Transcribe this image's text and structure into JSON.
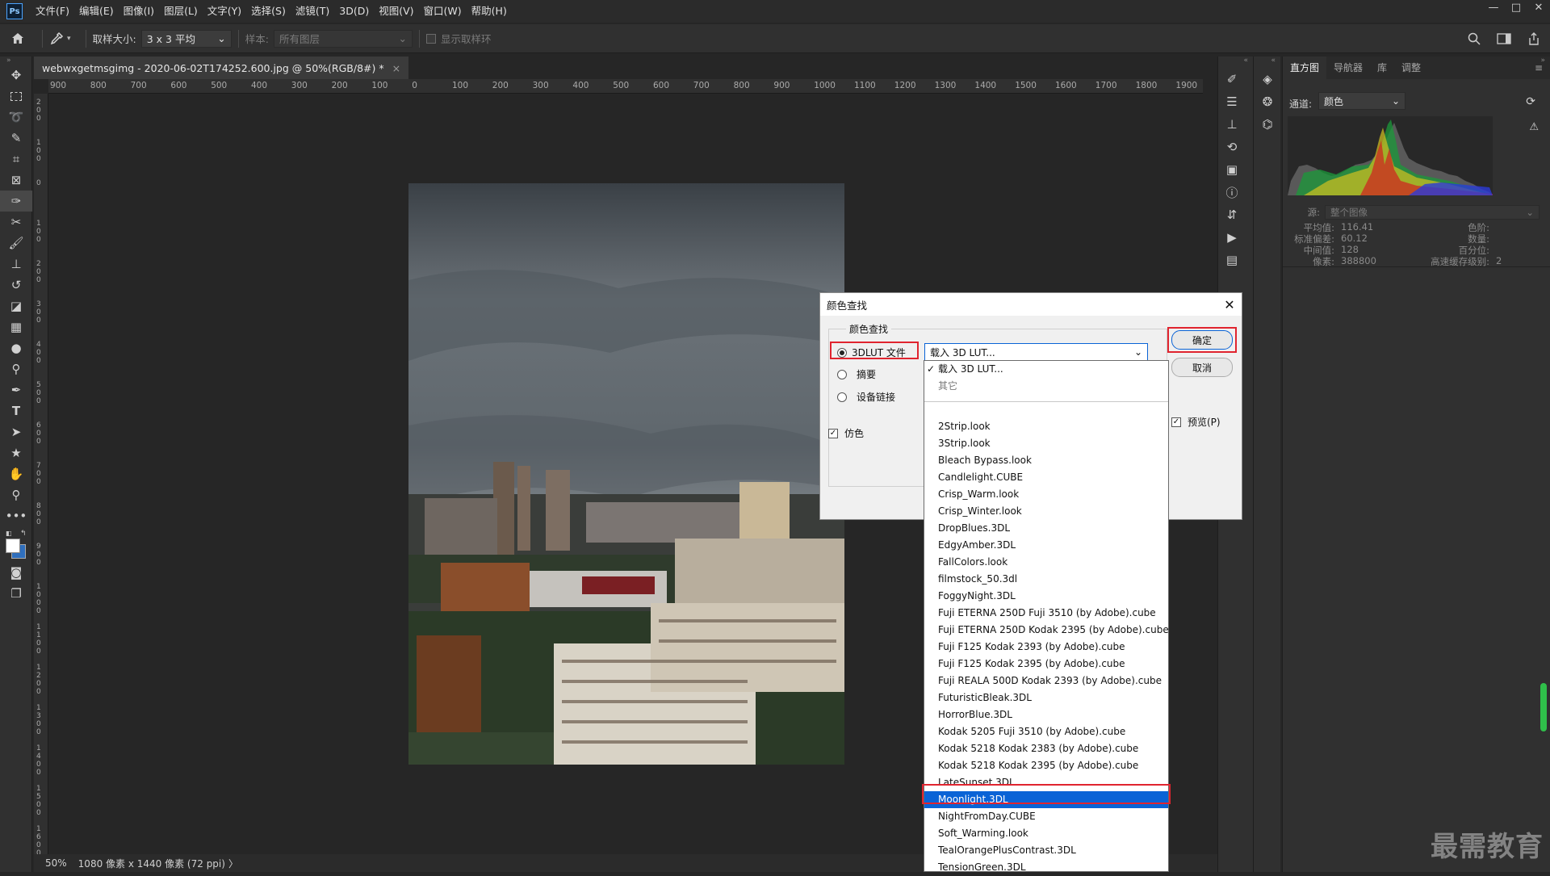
{
  "app": {
    "logo": "Ps",
    "menu": [
      "文件(F)",
      "编辑(E)",
      "图像(I)",
      "图层(L)",
      "文字(Y)",
      "选择(S)",
      "滤镜(T)",
      "3D(D)",
      "视图(V)",
      "窗口(W)",
      "帮助(H)"
    ],
    "window_controls": [
      "—",
      "□",
      "✕"
    ]
  },
  "options": {
    "sample_size_label": "取样大小:",
    "sample_size_value": "3 x 3 平均",
    "sample_label": "样本:",
    "sample_value": "所有图层",
    "show_ring_label": "显示取样环"
  },
  "document": {
    "tab_title": "webwxgetmsgimg - 2020-06-02T174252.600.jpg @ 50%(RGB/8#) *",
    "zoom": "50%",
    "info": "1080 像素 x 1440 像素 (72 ppi)"
  },
  "ruler_top": [
    "900",
    "800",
    "700",
    "600",
    "500",
    "400",
    "300",
    "200",
    "100",
    "0",
    "100",
    "200",
    "300",
    "400",
    "500",
    "600",
    "700",
    "800",
    "900",
    "1000",
    "1100",
    "1200",
    "1300",
    "1400",
    "1500",
    "1600",
    "1700",
    "1800",
    "1900"
  ],
  "ruler_left": [
    "2 0 0",
    "1 0 0",
    "0",
    "1 0 0",
    "2 0 0",
    "3 0 0",
    "4 0 0",
    "5 0 0",
    "6 0 0",
    "7 0 0",
    "8 0 0",
    "9 0 0",
    "1 0 0 0",
    "1 1 0 0",
    "1 2 0 0",
    "1 3 0 0",
    "1 4 0 0",
    "1 5 0 0",
    "1 6 0 0"
  ],
  "histogram": {
    "tabs": [
      "直方图",
      "导航器",
      "库",
      "调整"
    ],
    "channel_label": "通道:",
    "channel_value": "颜色",
    "source_label": "源:",
    "source_value": "整个图像",
    "stats_left": [
      {
        "label": "平均值:",
        "value": "116.41"
      },
      {
        "label": "标准偏差:",
        "value": "60.12"
      },
      {
        "label": "中间值:",
        "value": "128"
      },
      {
        "label": "像素:",
        "value": "388800"
      }
    ],
    "stats_right": [
      {
        "label": "色阶:",
        "value": ""
      },
      {
        "label": "数量:",
        "value": ""
      },
      {
        "label": "百分位:",
        "value": ""
      },
      {
        "label": "高速缓存级别:",
        "value": "2"
      }
    ]
  },
  "dialog": {
    "title": "颜色查找",
    "group_title": "颜色查找",
    "options": [
      "3DLUT 文件",
      "摘要",
      "设备链接"
    ],
    "dither_label": "仿色",
    "lut_select_value": "载入 3D LUT...",
    "ok_label": "确定",
    "cancel_label": "取消",
    "preview_label": "预览(P)"
  },
  "dropdown": {
    "checked_item": "载入 3D LUT...",
    "other_label": "其它",
    "items": [
      "2Strip.look",
      "3Strip.look",
      "Bleach Bypass.look",
      "Candlelight.CUBE",
      "Crisp_Warm.look",
      "Crisp_Winter.look",
      "DropBlues.3DL",
      "EdgyAmber.3DL",
      "FallColors.look",
      "filmstock_50.3dl",
      "FoggyNight.3DL",
      "Fuji ETERNA 250D Fuji 3510 (by Adobe).cube",
      "Fuji ETERNA 250D Kodak 2395 (by Adobe).cube",
      "Fuji F125 Kodak 2393 (by Adobe).cube",
      "Fuji F125 Kodak 2395 (by Adobe).cube",
      "Fuji REALA 500D Kodak 2393 (by Adobe).cube",
      "FuturisticBleak.3DL",
      "HorrorBlue.3DL",
      "Kodak 5205 Fuji 3510 (by Adobe).cube",
      "Kodak 5218 Kodak 2383 (by Adobe).cube",
      "Kodak 5218 Kodak 2395 (by Adobe).cube",
      "LateSunset.3DL",
      "Moonlight.3DL",
      "NightFromDay.CUBE",
      "Soft_Warming.look",
      "TealOrangePlusContrast.3DL",
      "TensionGreen.3DL"
    ],
    "selected_item": "Moonlight.3DL"
  },
  "watermark": "最需教育",
  "colors": {
    "accent": "#0a63d6",
    "highlight": "#e0242f"
  }
}
